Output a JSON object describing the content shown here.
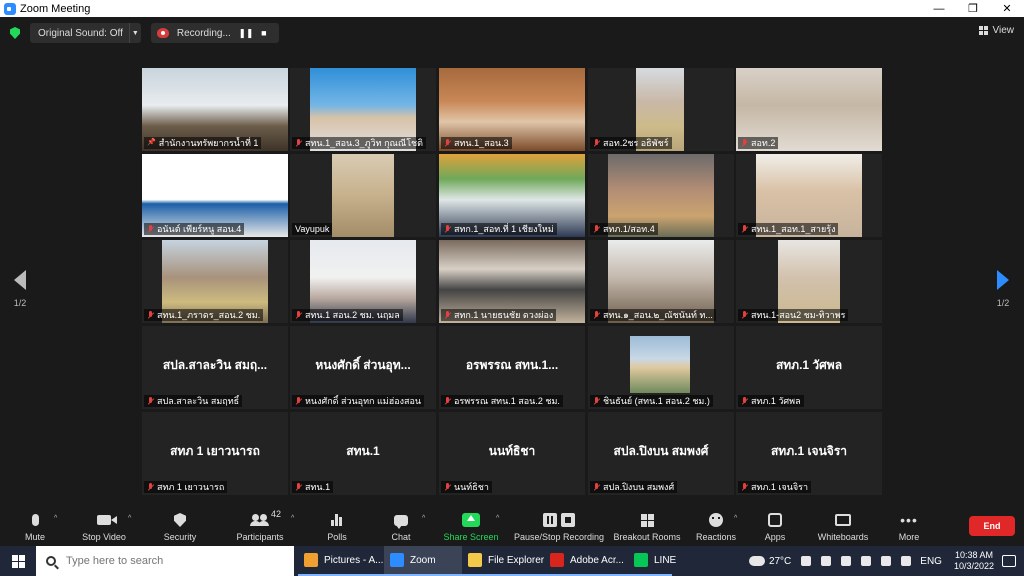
{
  "window": {
    "title": "Zoom Meeting",
    "minimize": "—",
    "maximize": "❐",
    "close": "✕"
  },
  "topbar": {
    "sound_label": "Original Sound: Off",
    "recording_label": "Recording...",
    "pause_glyph": "❚❚",
    "stop_glyph": "■",
    "view_label": "View"
  },
  "pagination": {
    "current_left": "1/2",
    "current_right": "1/2"
  },
  "participants": [
    {
      "name": "สำนักงานทรัพยากรน้ำที่ 1",
      "video": true,
      "active": true,
      "muted": false,
      "pin": true
    },
    {
      "name": "สทน.1_สอน.3_ภูวิท กุณณีโชติ",
      "video": true,
      "muted": true
    },
    {
      "name": "สทน.1_สอน.3",
      "video": true,
      "muted": true
    },
    {
      "name": "สอท.2ชร อธิพัชร์",
      "video": true,
      "muted": true
    },
    {
      "name": "สอท.2",
      "video": true,
      "muted": true
    },
    {
      "name": "อนันต์ เพียร์หนู สอน.4",
      "video": true,
      "muted": true
    },
    {
      "name": "Vayupuk",
      "video": true,
      "muted": false
    },
    {
      "name": "สทก.1_สอท.ที่ 1 เชียงใหม่",
      "video": true,
      "muted": true
    },
    {
      "name": "สทภ.1/สอท.4",
      "video": true,
      "muted": true
    },
    {
      "name": "สทน.1_สอท.1_สายรุ้ง",
      "video": true,
      "muted": true
    },
    {
      "name": "สทน.1_ภราดร_สอน.2 ชม.",
      "video": true,
      "muted": true
    },
    {
      "name": "สทน.1 สอน.2 ชม. นฤมล",
      "video": true,
      "muted": true
    },
    {
      "name": "สทก.1 นายธนชัย ดวงผ่อง",
      "video": true,
      "muted": true
    },
    {
      "name": "สทน.๑_สอน.๒_ณัชนันท์ ท...",
      "video": true,
      "muted": true
    },
    {
      "name": "สทน.1-สอน2 ชม-ทิวาพร",
      "video": true,
      "muted": true
    },
    {
      "name": "สปล.สาละวิน สมฤทธิ์",
      "display": "สปล.สาละวิน สมฤ...",
      "video": false,
      "muted": true
    },
    {
      "name": "หนงศักดิ์ ส่วนอุทก แม่ฮ่องสอน",
      "display": "หนงศักดิ์ ส่วนอุท...",
      "video": false,
      "muted": true
    },
    {
      "name": "อรพรรณ สทน.1 สอน.2 ชม.",
      "display": "อรพรรณ สทน.1...",
      "video": false,
      "muted": true
    },
    {
      "name": "ชินธันย์ (สทน.1 สอน.2 ชม.)",
      "video": "small",
      "muted": true
    },
    {
      "name": "สทภ.1 วัศพล",
      "display": "สทภ.1 วัศพล",
      "video": false,
      "muted": true
    },
    {
      "name": "สทภ 1 เยาวนารถ",
      "display": "สทภ 1 เยาวนารถ",
      "video": false,
      "muted": true
    },
    {
      "name": "สทน.1",
      "display": "สทน.1",
      "video": false,
      "muted": true
    },
    {
      "name": "นนท์ธิชา",
      "display": "นนท์ธิชา",
      "video": false,
      "muted": true
    },
    {
      "name": "สปล.ปิงบน สมพงศ์",
      "display": "สปล.ปิงบน สมพงศ์",
      "video": false,
      "muted": true
    },
    {
      "name": "สทภ.1 เจนจิรา",
      "display": "สทภ.1 เจนจิรา",
      "video": false,
      "muted": true
    }
  ],
  "toolbar": {
    "mute": "Mute",
    "stop_video": "Stop Video",
    "security": "Security",
    "participants": "Participants",
    "participants_count": "42",
    "polls": "Polls",
    "chat": "Chat",
    "share_screen": "Share Screen",
    "pause_stop_recording": "Pause/Stop Recording",
    "breakout_rooms": "Breakout Rooms",
    "reactions": "Reactions",
    "apps": "Apps",
    "whiteboards": "Whiteboards",
    "more": "More",
    "more_glyph": "•••",
    "end": "End",
    "caret": "^"
  },
  "taskbar": {
    "search_placeholder": "Type here to search",
    "apps": [
      {
        "label": "Pictures - A...",
        "color": "#f0a030"
      },
      {
        "label": "Zoom",
        "color": "#2d8cff",
        "active": true
      },
      {
        "label": "File Explorer",
        "color": "#f3c94b"
      },
      {
        "label": "Adobe Acr...",
        "color": "#d8261c"
      },
      {
        "label": "LINE",
        "color": "#06c755"
      }
    ],
    "weather": "27°C",
    "language": "ENG",
    "time": "10:38 AM",
    "date": "10/3/2022"
  },
  "colors": {
    "accent": "#2d8cff",
    "active_speaker": "#cfe93a",
    "end_red": "#e02828",
    "share_green": "#23d959",
    "muted_red": "#e34040"
  }
}
